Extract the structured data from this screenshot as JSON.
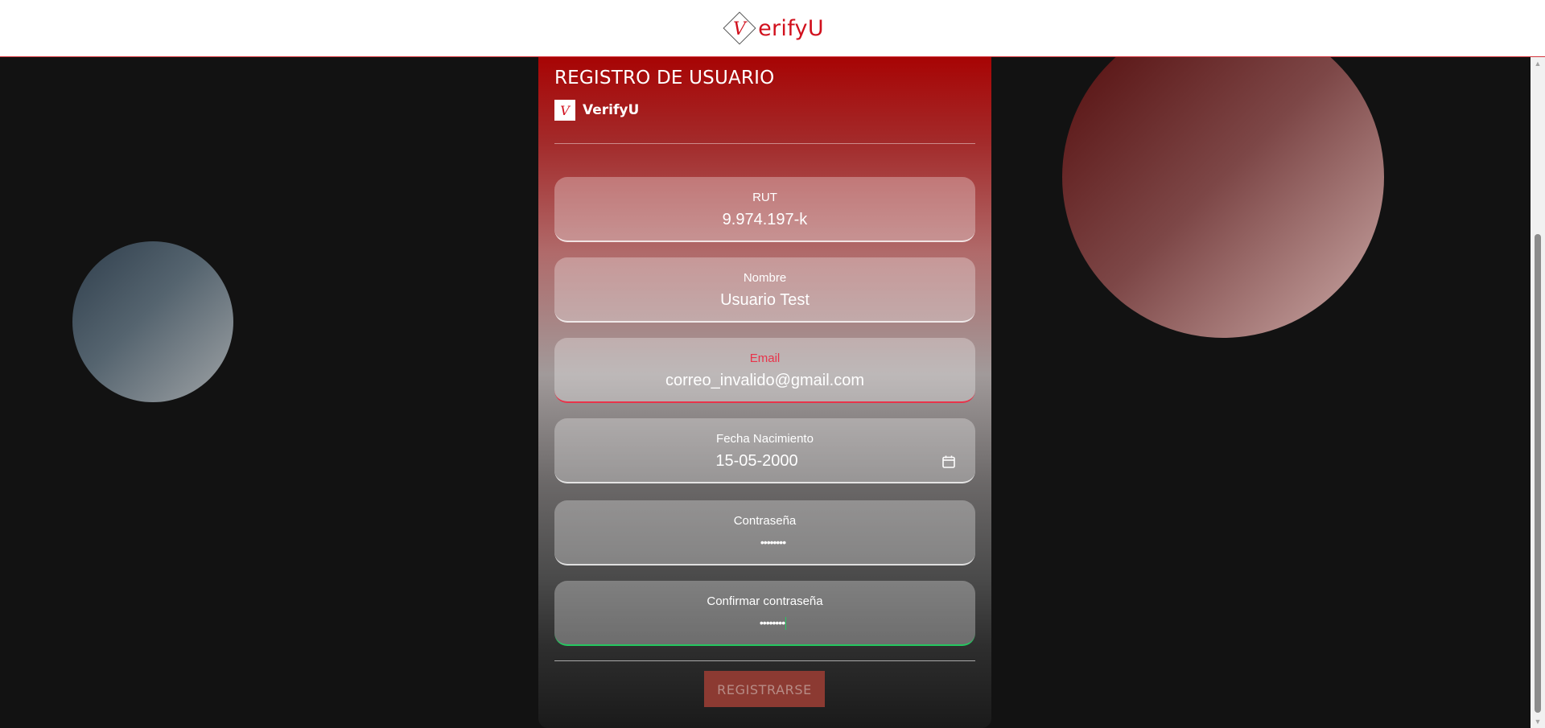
{
  "header": {
    "logo_text": "erifyU",
    "logo_letter": "V"
  },
  "form": {
    "title": "REGISTRO DE USUARIO",
    "brand_name": "VerifyU",
    "brand_letter": "V",
    "fields": [
      {
        "label": "RUT",
        "value": "9.974.197-k"
      },
      {
        "label": "Nombre",
        "value": "Usuario Test"
      },
      {
        "label": "Email",
        "value": "correo_invalido@gmail.com",
        "state": "invalid"
      },
      {
        "label": "Fecha Nacimiento",
        "value": "15-05-2000"
      },
      {
        "label": "Contraseña",
        "value": "••••••••"
      },
      {
        "label": "Confirmar contraseña",
        "value": "••••••••",
        "state": "valid"
      }
    ],
    "submit_label": "REGISTRARSE"
  },
  "colors": {
    "brand_red": "#d1101d",
    "invalid": "#e8334a",
    "valid": "#25c760",
    "background": "#121212"
  },
  "icons": {
    "logo": "verifyu-logo-icon",
    "calendar": "calendar-icon",
    "scroll_up": "scroll-up-arrow-icon",
    "scroll_down": "scroll-down-arrow-icon"
  }
}
